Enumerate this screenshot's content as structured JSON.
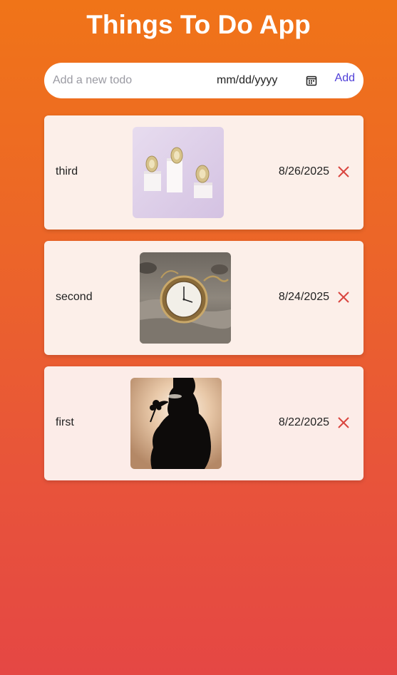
{
  "app": {
    "title": "Things To Do App"
  },
  "form": {
    "placeholder": "Add a new todo",
    "date_placeholder": "mm/dd/yyyy",
    "add_label": "Add"
  },
  "todos": [
    {
      "text": "third",
      "date": "8/26/2025",
      "image": "pedestals-with-gold-coins-photo"
    },
    {
      "text": "second",
      "date": "8/24/2025",
      "image": "pocket-watch-in-sand-photo"
    },
    {
      "text": "first",
      "date": "8/22/2025",
      "image": "pregnant-silhouette-with-flower-photo"
    }
  ],
  "colors": {
    "gradient_top": "#f07418",
    "gradient_bottom": "#e54744",
    "card_background": "#fcefe9",
    "card_background_alt": "#fcece8",
    "add_link": "#4f3fd8",
    "delete_icon": "#d9453f"
  }
}
